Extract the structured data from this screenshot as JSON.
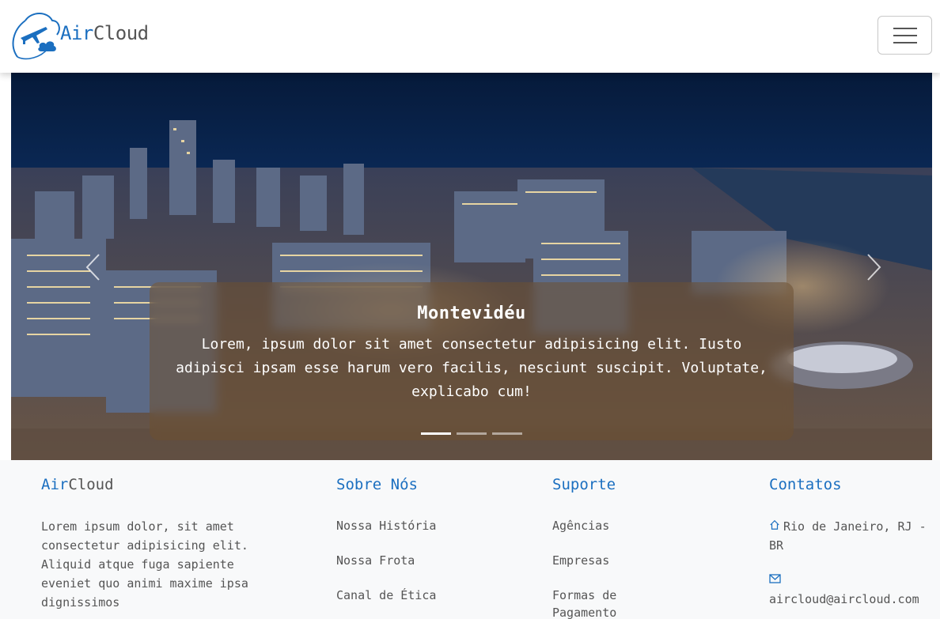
{
  "brand": {
    "air": "Air",
    "cloud": "Cloud"
  },
  "nav": {
    "toggler_label": "menu"
  },
  "carousel": {
    "caption_title": "Montevidéu",
    "caption_text": "Lorem, ipsum dolor sit amet consectetur adipisicing elit. Iusto adipisci ipsam esse harum vero facilis, nesciunt suscipit. Voluptate, explicabo cum!",
    "active_index": 0,
    "slide_count": 3
  },
  "footer": {
    "col1": {
      "title_air": "Air",
      "title_cloud": "Cloud",
      "text": "Lorem ipsum dolor, sit amet consectetur adipisicing elit. Aliquid atque fuga sapiente eveniet quo animi maxime ipsa dignissimos"
    },
    "col2": {
      "title": "Sobre Nós",
      "links": [
        "Nossa História",
        "Nossa Frota",
        "Canal de Ética"
      ]
    },
    "col3": {
      "title": "Suporte",
      "links": [
        "Agências",
        "Empresas",
        "Formas de Pagamento"
      ]
    },
    "col4": {
      "title": "Contatos",
      "address": "Rio de Janeiro, RJ - BR",
      "email": "aircloud@aircloud.com",
      "address_icon": "home-icon",
      "email_icon": "envelope-icon"
    }
  },
  "colors": {
    "brand_blue": "#1b6fc0",
    "text_gray": "#555555",
    "footer_bg": "#f8f9fa"
  }
}
